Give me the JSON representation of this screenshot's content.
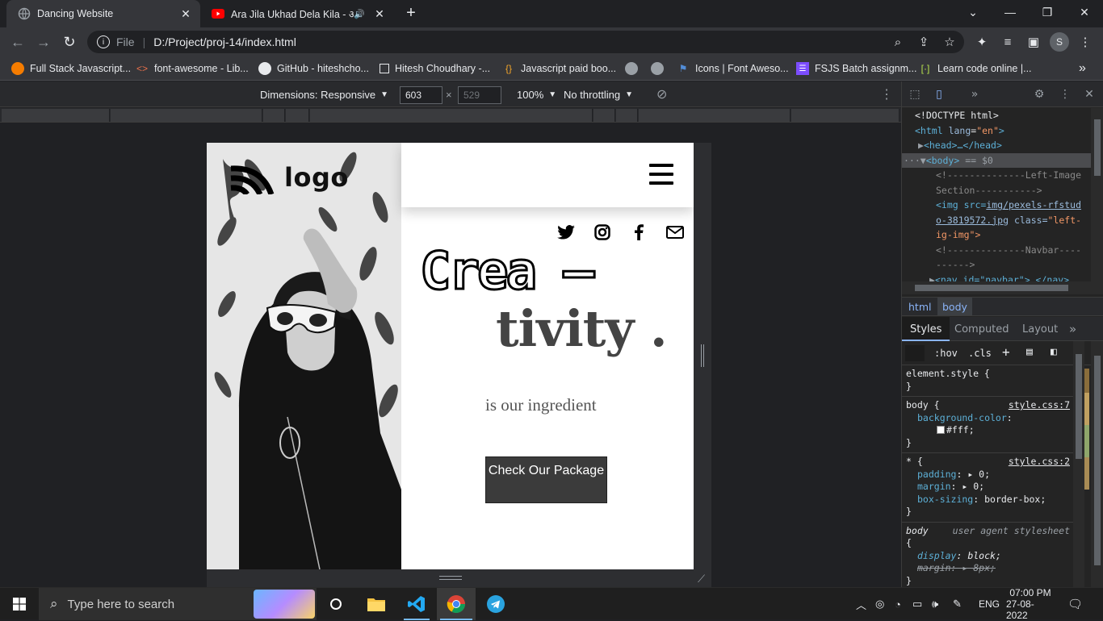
{
  "browser": {
    "tabs": [
      {
        "title": "Dancing Website",
        "active": true
      },
      {
        "title": "Ara Jila Ukhad Dela Kila - आ",
        "active": false
      }
    ],
    "new_tab": "+",
    "address": {
      "scheme_label": "File",
      "url": "D:/Project/proj-14/index.html"
    },
    "profile_initial": "S",
    "bookmarks": [
      "Full Stack Javascript...",
      "font-awesome - Lib...",
      "GitHub - hiteshcho...",
      "Hitesh Choudhary -...",
      "Javascript paid boo...",
      "Icons | Font Aweso...",
      "FSJS Batch assignm...",
      "Learn code online |..."
    ],
    "bookmarks_overflow": "»"
  },
  "device_toolbar": {
    "dimensions_label": "Dimensions: Responsive",
    "width": "603",
    "height": "529",
    "times": "×",
    "zoom": "100%",
    "throttling": "No throttling"
  },
  "site": {
    "logo": "logo",
    "headline_1": "Crea –",
    "headline_2": "tivity .",
    "tagline": "is our ingredient",
    "cta": "Check Our Package",
    "social_icons": [
      "twitter-icon",
      "instagram-icon",
      "facebook-icon",
      "mail-icon"
    ]
  },
  "devtools": {
    "elements": {
      "doctype": "<!DOCTYPE html>",
      "html_open": "<html",
      "lang_attr": "lang",
      "lang_val": "\"en\"",
      "head": "<head>…</head>",
      "body": "<body>",
      "body_suffix": "== $0",
      "comment_1a": "<!--------------Left-Image",
      "comment_1b": "Section----------->",
      "img_open": "<img src=",
      "img_src_a": "img/pexels-rfstud",
      "img_src_b": "o-3819572.jpg",
      "img_class_attr": "class=",
      "img_class_a": "\"left-",
      "img_class_b": "ig-img\">",
      "comment_2a": "<!--------------Navbar----",
      "comment_2b": "------>",
      "nav_partial": "<nav id=\"navbar\">…</nav>"
    },
    "breadcrumbs": [
      "html",
      "body"
    ],
    "style_tabs": [
      "Styles",
      "Computed",
      "Layout"
    ],
    "filter_buttons": [
      ":hov",
      ".cls",
      "+"
    ],
    "rules": {
      "element_style": "element.style {",
      "body_sel": "body {",
      "body_src": "style.css:7",
      "body_prop": "background-color",
      "body_val": "#fff;",
      "star_sel": "* {",
      "star_src": "style.css:2",
      "padding_prop": "padding",
      "padding_val": "0;",
      "margin_prop": "margin",
      "margin_val": "0;",
      "boxsizing_prop": "box-sizing",
      "boxsizing_val": "border-box;",
      "ua_sel": "body",
      "ua_src": "user agent stylesheet",
      "display_prop": "display",
      "display_val": "block;",
      "ua_margin_prop": "margin",
      "ua_margin_val": "8px;",
      "open_brace": "{",
      "close_brace": "}"
    }
  },
  "taskbar": {
    "search_placeholder": "Type here to search",
    "language": "ENG",
    "time": "07:00 PM",
    "date": "27-08-2022"
  },
  "colors": {
    "accent_blue": "#8ab4f8",
    "page_bg": "#ffffff",
    "cta_bg": "#3b3b3b"
  }
}
